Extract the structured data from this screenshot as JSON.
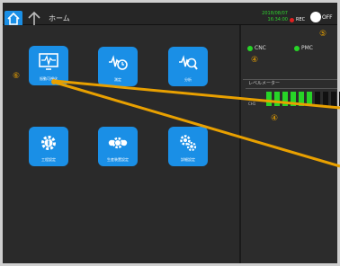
{
  "header": {
    "title": "ホーム",
    "date": "2018/08/07",
    "time": "16:34:00",
    "rec_label": "REC",
    "toggle_label": "OFF"
  },
  "tiles": [
    {
      "label": "振動可視化",
      "icon": "waveform-monitor-icon"
    },
    {
      "label": "測定",
      "icon": "waveform-clock-icon"
    },
    {
      "label": "分析",
      "icon": "waveform-search-icon"
    },
    {
      "label": "工程設定",
      "icon": "gear-info-icon"
    },
    {
      "label": "生産装置設定",
      "icon": "multi-gear-icon"
    },
    {
      "label": "詳細設定",
      "icon": "gears-icon"
    }
  ],
  "status": {
    "cnc_label": "CNC",
    "pmc_label": "PMC"
  },
  "level": {
    "label": "レベルメーター",
    "channel": "CH1",
    "green_segments": 6,
    "total_segments": 10
  },
  "annotations": {
    "a4_top": "④",
    "a4_mid": "④",
    "a5": "⑤",
    "a6": "⑥"
  },
  "colors": {
    "accent": "#1a8fe6",
    "led_green": "#27d427",
    "annotation": "#e8a000",
    "rec_red": "#e02020"
  }
}
